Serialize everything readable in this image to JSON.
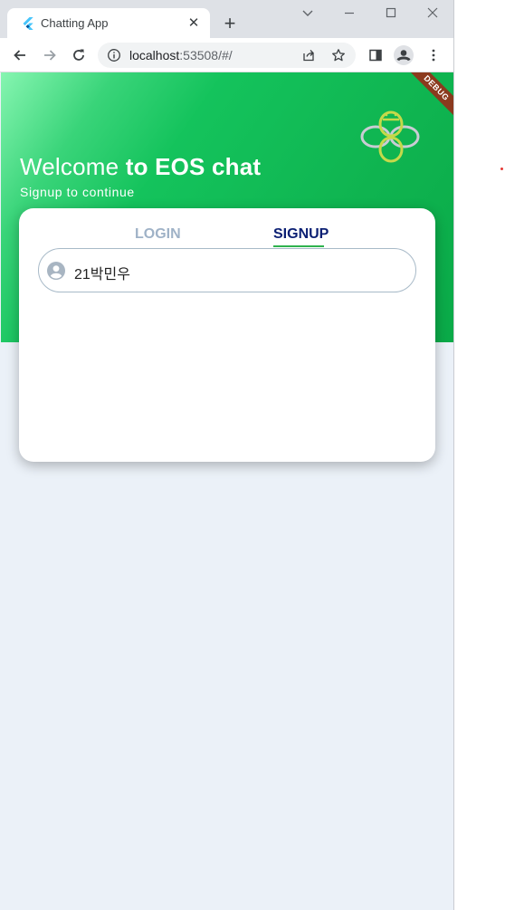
{
  "browser": {
    "tab_title": "Chatting App",
    "tab_close": "✕",
    "new_tab": "+",
    "url_host": "localhost",
    "url_rest": ":53508/#/"
  },
  "app": {
    "debug_banner": "DEBUG",
    "welcome_light": "Welcome ",
    "welcome_bold": "to EOS chat",
    "subtitle": "Signup to continue",
    "tabs": [
      {
        "label": "LOGIN",
        "active": false
      },
      {
        "label": "SIGNUP",
        "active": true
      }
    ],
    "name_field_value": "21박민우"
  },
  "colors": {
    "hero_green": "#0fb450",
    "active_tab": "#0b1f73",
    "inactive_tab": "#9fb2c7",
    "tab_indicator": "#2fb24e",
    "page_bg": "#ebf1f8"
  },
  "icons": [
    "flutter-favicon-icon",
    "close-icon",
    "plus-icon",
    "chevron-down-icon",
    "minimize-icon",
    "maximize-icon",
    "close-window-icon",
    "back-arrow-icon",
    "forward-arrow-icon",
    "reload-icon",
    "info-icon",
    "share-icon",
    "star-icon",
    "side-panel-icon",
    "profile-icon",
    "kebab-menu-icon",
    "app-logo-icon",
    "account-circle-icon"
  ]
}
